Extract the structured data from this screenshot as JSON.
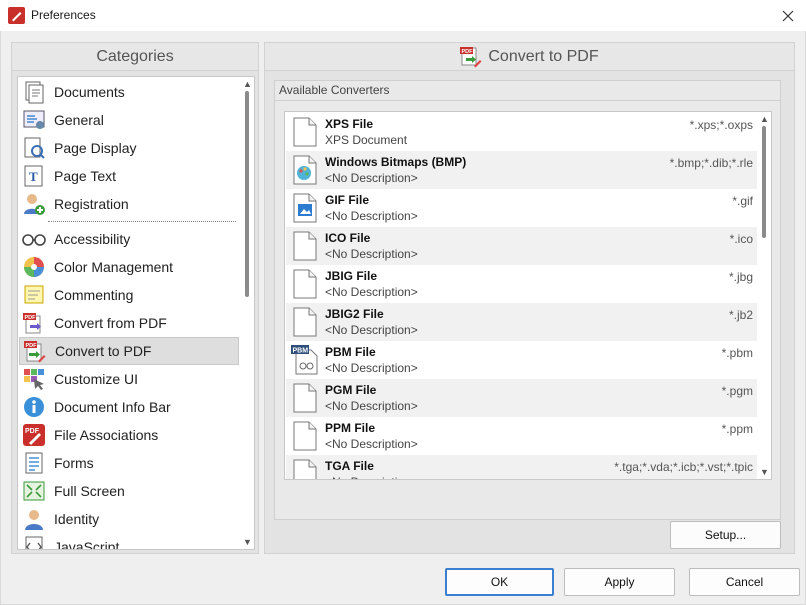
{
  "window": {
    "title": "Preferences",
    "app_icon": "pdf-app-icon",
    "close_glyph": "✕"
  },
  "categories": {
    "header": "Categories",
    "items": [
      {
        "label": "Documents",
        "icon": "documents-icon"
      },
      {
        "label": "General",
        "icon": "general-icon"
      },
      {
        "label": "Page Display",
        "icon": "page-display-icon"
      },
      {
        "label": "Page Text",
        "icon": "page-text-icon"
      },
      {
        "label": "Registration",
        "icon": "registration-icon"
      },
      {
        "label": "Accessibility",
        "icon": "accessibility-icon"
      },
      {
        "label": "Color Management",
        "icon": "color-management-icon"
      },
      {
        "label": "Commenting",
        "icon": "commenting-icon"
      },
      {
        "label": "Convert from PDF",
        "icon": "convert-from-pdf-icon"
      },
      {
        "label": "Convert to PDF",
        "icon": "convert-to-pdf-icon",
        "selected": true
      },
      {
        "label": "Customize UI",
        "icon": "customize-ui-icon"
      },
      {
        "label": "Document Info Bar",
        "icon": "document-info-bar-icon"
      },
      {
        "label": "File Associations",
        "icon": "file-associations-icon"
      },
      {
        "label": "Forms",
        "icon": "forms-icon"
      },
      {
        "label": "Full Screen",
        "icon": "full-screen-icon"
      },
      {
        "label": "Identity",
        "icon": "identity-icon"
      },
      {
        "label": "JavaScript",
        "icon": "javascript-icon"
      }
    ]
  },
  "content": {
    "header": "Convert to PDF",
    "group_title": "Available Converters",
    "converters": [
      {
        "name": "XPS File",
        "desc": "XPS Document",
        "ext": "*.xps;*.oxps",
        "icon": "blank-file-icon"
      },
      {
        "name": "Windows Bitmaps (BMP)",
        "desc": "<No Description>",
        "ext": "*.bmp;*.dib;*.rle",
        "icon": "bmp-paint-icon"
      },
      {
        "name": "GIF File",
        "desc": "<No Description>",
        "ext": "*.gif",
        "icon": "image-file-icon"
      },
      {
        "name": "ICO File",
        "desc": "<No Description>",
        "ext": "*.ico",
        "icon": "blank-file-icon"
      },
      {
        "name": "JBIG File",
        "desc": "<No Description>",
        "ext": "*.jbg",
        "icon": "blank-file-icon"
      },
      {
        "name": "JBIG2 File",
        "desc": "<No Description>",
        "ext": "*.jb2",
        "icon": "blank-file-icon"
      },
      {
        "name": "PBM File",
        "desc": "<No Description>",
        "ext": "*.pbm",
        "icon": "pbm-file-icon",
        "badge": "PBM"
      },
      {
        "name": "PGM File",
        "desc": "<No Description>",
        "ext": "*.pgm",
        "icon": "blank-file-icon"
      },
      {
        "name": "PPM File",
        "desc": "<No Description>",
        "ext": "*.ppm",
        "icon": "blank-file-icon"
      },
      {
        "name": "TGA File",
        "desc": "<No Description>",
        "ext": "*.tga;*.vda;*.icb;*.vst;*.tpic",
        "icon": "blank-file-icon"
      }
    ],
    "setup_label": "Setup..."
  },
  "buttons": {
    "ok": "OK",
    "apply": "Apply",
    "cancel": "Cancel"
  },
  "colors": {
    "accent": "#3c7fd1",
    "pdf_red": "#c9302c",
    "selection": "#dedede"
  }
}
